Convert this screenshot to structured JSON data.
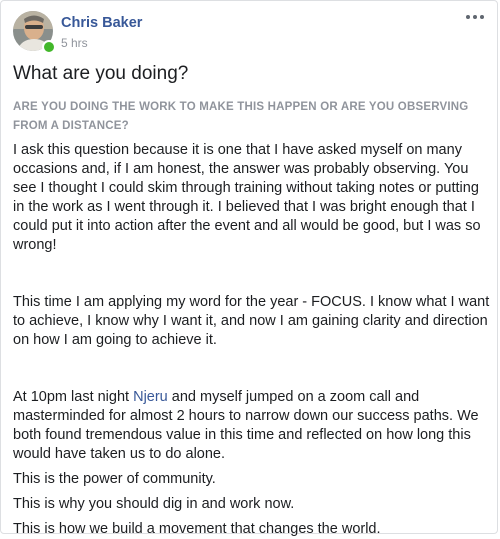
{
  "post": {
    "author": "Chris Baker",
    "time": "5 hrs",
    "title": "What are you doing?",
    "subtitle": "ARE YOU DOING THE WORK TO MAKE THIS HAPPEN OR ARE YOU OBSERVING FROM A DISTANCE?",
    "paragraph_1": "I ask this question because it is one that I have asked myself on many occasions and, if I am honest, the answer was probably observing. You see I thought I could skim through training without taking notes or putting in the work as I went through it. I believed that I was bright enough that I could put it into action after the event and all would be good, but I was so wrong!",
    "paragraph_2": "This time I am applying my word for the year - FOCUS.  I know what I want to achieve, I know why I want it, and now I am gaining clarity and direction on how I am going to achieve it.",
    "paragraph_3_before": "At 10pm last night ",
    "paragraph_3_mention": "Njeru",
    "paragraph_3_after": " and myself jumped on a zoom call and masterminded for almost 2 hours to narrow down our success paths. We both found tremendous value in this time and reflected on how long this would have taken us to do alone.",
    "line_1": "This is the power of community.",
    "line_2": "This is why you should dig in and work now.",
    "line_3": "This is how we build a movement that changes the world."
  },
  "colors": {
    "link": "#385898",
    "online": "#42b72a",
    "muted": "#90949c",
    "text": "#1c1e21"
  },
  "icons": {
    "avatar": "profile-photo",
    "more": "more-options-icon",
    "status": "online-status-icon"
  }
}
